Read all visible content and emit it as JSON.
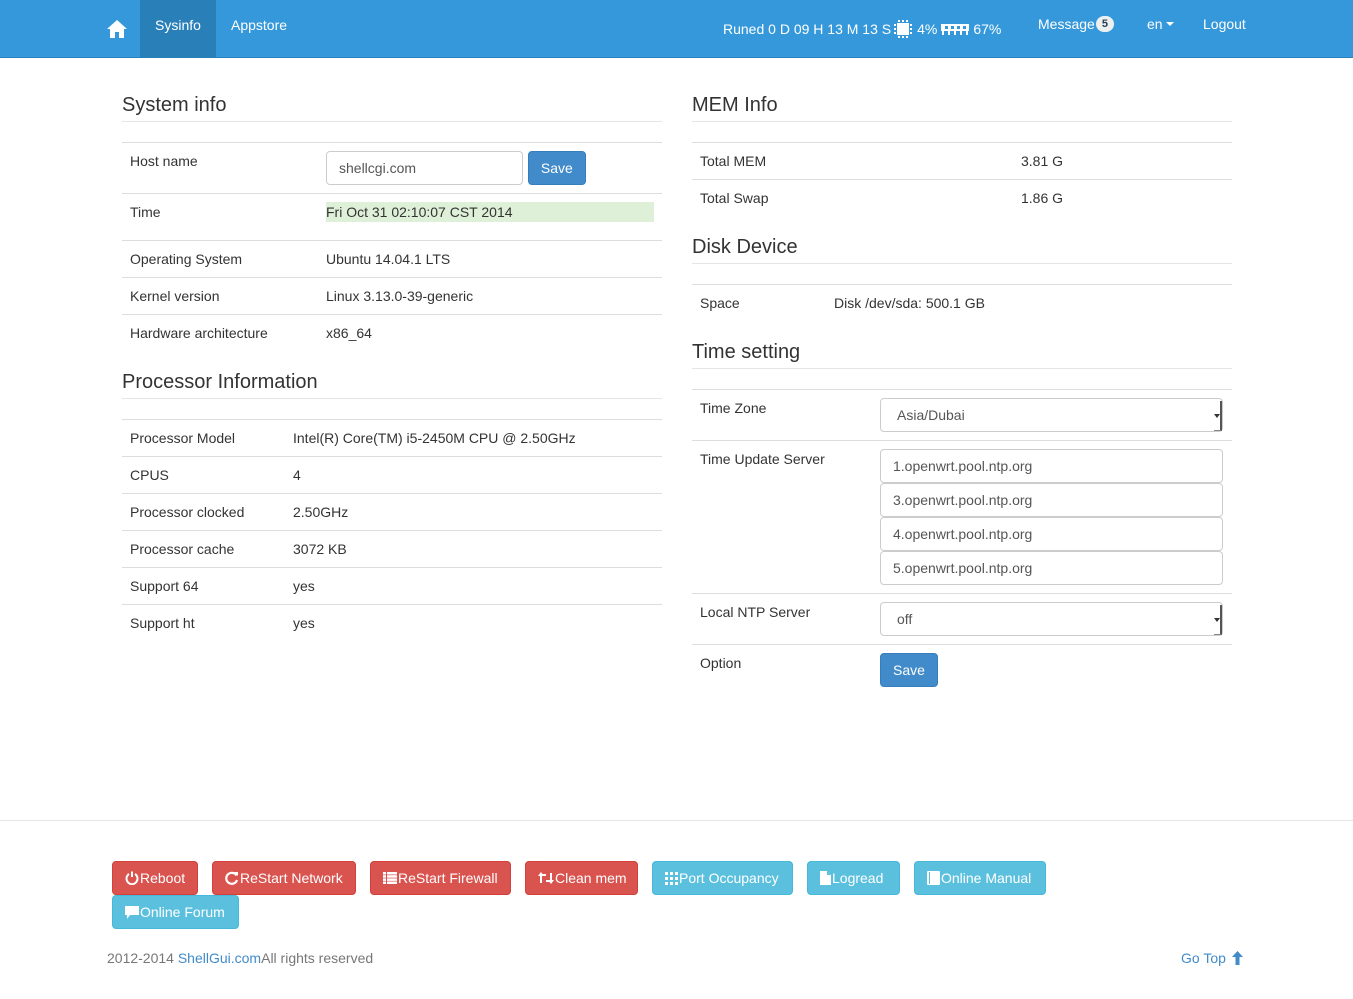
{
  "nav": {
    "home_icon": "home-icon",
    "tabs": [
      {
        "label": "Sysinfo",
        "active": true
      },
      {
        "label": "Appstore",
        "active": false
      }
    ],
    "status": {
      "uptime": "Runed 0 D 09 H 13 M 13 S",
      "cpu_icon": "cpu-chip-icon",
      "cpu_percent": "4%",
      "mem_icon": "memory-module-icon",
      "mem_percent": "67%"
    },
    "message_label": "Message",
    "message_count": "5",
    "language": "en",
    "logout_label": "Logout"
  },
  "system_info": {
    "title": "System info",
    "host_name_label": "Host name",
    "host_name_value": "shellcgi.com",
    "save_label": "Save",
    "time_label": "Time",
    "time_value": "Fri Oct 31 02:10:07 CST 2014",
    "rows": [
      {
        "label": "Operating System",
        "value": "Ubuntu 14.04.1 LTS"
      },
      {
        "label": "Kernel version",
        "value": "Linux 3.13.0-39-generic"
      },
      {
        "label": "Hardware architecture",
        "value": "x86_64"
      }
    ]
  },
  "processor": {
    "title": "Processor Information",
    "rows": [
      {
        "label": "Processor Model",
        "value": "Intel(R) Core(TM) i5-2450M CPU @ 2.50GHz"
      },
      {
        "label": "CPUS",
        "value": "4"
      },
      {
        "label": "Processor clocked",
        "value": "2.50GHz"
      },
      {
        "label": "Processor cache",
        "value": "3072 KB"
      },
      {
        "label": "Support 64",
        "value": "yes"
      },
      {
        "label": "Support ht",
        "value": "yes"
      }
    ]
  },
  "mem": {
    "title": "MEM Info",
    "rows": [
      {
        "label": "Total MEM",
        "value": "3.81 G"
      },
      {
        "label": "Total Swap",
        "value": "1.86 G"
      }
    ]
  },
  "disk": {
    "title": "Disk Device",
    "rows": [
      {
        "label": "Space",
        "value": "Disk /dev/sda: 500.1 GB"
      }
    ]
  },
  "time_setting": {
    "title": "Time setting",
    "timezone_label": "Time Zone",
    "timezone_value": "Asia/Dubai",
    "update_server_label": "Time Update Server",
    "servers": [
      "1.openwrt.pool.ntp.org",
      "3.openwrt.pool.ntp.org",
      "4.openwrt.pool.ntp.org",
      "5.openwrt.pool.ntp.org"
    ],
    "local_ntp_label": "Local NTP Server",
    "local_ntp_value": "off",
    "option_label": "Option",
    "save_label": "Save"
  },
  "actions": [
    {
      "label": "Reboot",
      "icon": "power-icon",
      "style": "danger"
    },
    {
      "label": "ReStart Network",
      "icon": "refresh-icon",
      "style": "danger"
    },
    {
      "label": "ReStart Firewall",
      "icon": "list-icon",
      "style": "danger"
    },
    {
      "label": "Clean mem",
      "icon": "retweet-icon",
      "style": "danger"
    },
    {
      "label": "Port Occupancy",
      "icon": "grid-icon",
      "style": "info"
    },
    {
      "label": "Logread",
      "icon": "file-icon",
      "style": "info"
    },
    {
      "label": "Online Manual",
      "icon": "book-icon",
      "style": "info"
    },
    {
      "label": "Online Forum",
      "icon": "comment-icon",
      "style": "info"
    }
  ],
  "footer": {
    "years": "2012-2014 ",
    "site_link": "ShellGui.com",
    "rights": "All rights reserved",
    "go_top": "Go Top"
  },
  "colors": {
    "navbar": "#3498db",
    "navbar_active": "#2980b9",
    "primary": "#428bca",
    "danger": "#d9534f",
    "info": "#5bc0de",
    "success_bg": "#dff0d8"
  }
}
